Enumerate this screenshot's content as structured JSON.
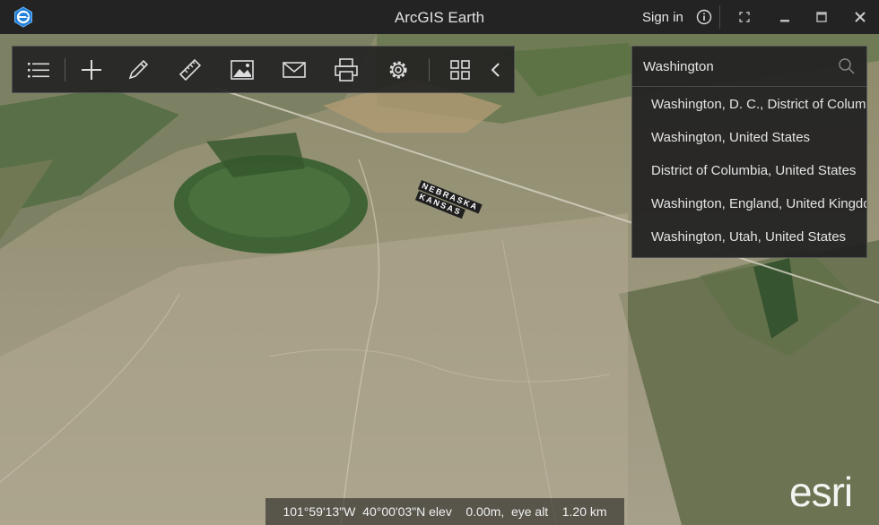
{
  "window": {
    "title": "ArcGIS Earth",
    "sign_in_label": "Sign in",
    "controls": [
      "info-icon",
      "fullscreen-icon",
      "minimize-icon",
      "maximize-icon",
      "close-icon"
    ]
  },
  "toolbar": {
    "tools": [
      "menu-icon",
      "add-icon",
      "draw-icon",
      "measure-icon",
      "image-icon",
      "mail-icon",
      "print-icon",
      "settings-icon",
      "grid-icon",
      "collapse-icon"
    ]
  },
  "search": {
    "value": "Washington",
    "results": [
      "Washington, D. C., District of Columbia",
      "Washington, United States",
      "District of Columbia, United States",
      "Washington, England, United Kingdom",
      "Washington, Utah, United States"
    ]
  },
  "map": {
    "state_label_top": "NEBRASKA",
    "state_label_bottom": "KANSAS"
  },
  "status": {
    "text": "101°59'13\"W  40°00'03\"N elev    0.00m,  eye alt    1.20 km"
  },
  "branding": {
    "logo_text": "esri"
  },
  "colors": {
    "titlebar": "#232323",
    "panel": "#232323",
    "logo_blue": "#1f7fd8"
  }
}
